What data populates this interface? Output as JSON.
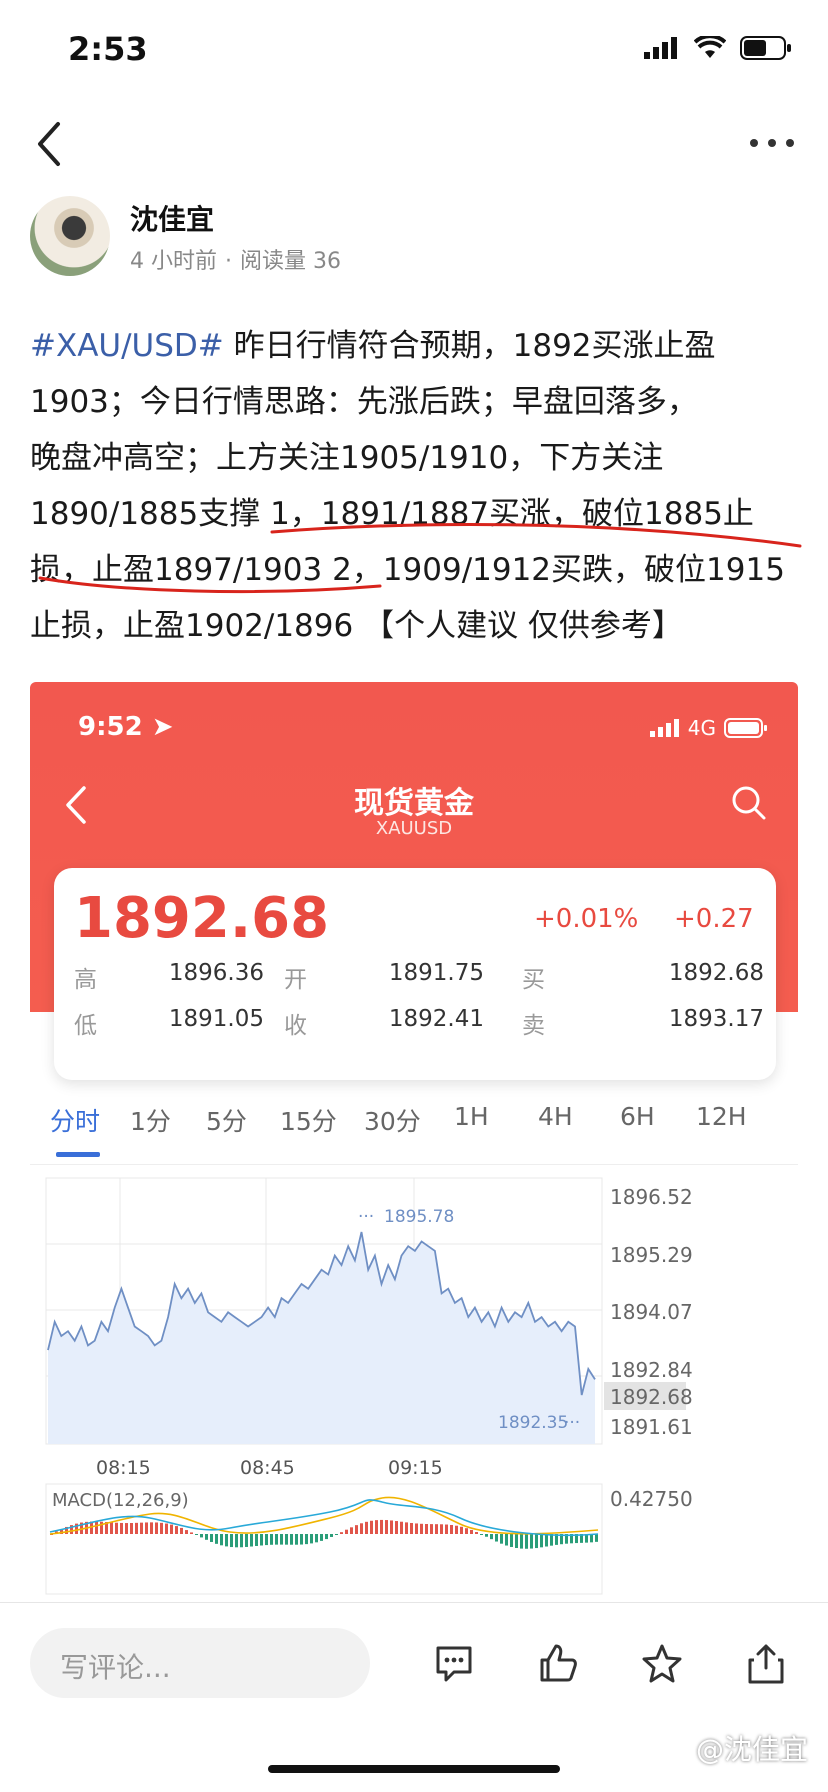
{
  "status_bar": {
    "time": "2:53"
  },
  "author": {
    "name": "沈佳宜",
    "time_ago": "4 小时前",
    "reads_label": "阅读量 36"
  },
  "post": {
    "hashtag": "#XAU/USD#",
    "lines": [
      " 昨日行情符合预期，1892买涨止盈",
      "1903；今日行情思路：先涨后跌；早盘回落多，",
      "晚盘冲高空；上方关注1905/1910，下方关注",
      "1890/1885支撑 1，1891/1887买涨，破位1885止",
      "损，止盈1897/1903 2，1909/1912买跌，破位1915",
      "止损，止盈1902/1896 【个人建议 仅供参考】"
    ]
  },
  "screenshot": {
    "time": "9:52",
    "network": "4G",
    "title": "现货黄金",
    "subtitle": "XAUUSD",
    "price": "1892.68",
    "change_pct": "+0.01%",
    "change_abs": "+0.27",
    "rows": [
      {
        "l1": "高",
        "v1": "1896.36",
        "l2": "开",
        "v2": "1891.75",
        "l3": "买",
        "v3": "1892.68"
      },
      {
        "l1": "低",
        "v1": "1891.05",
        "l2": "收",
        "v2": "1892.41",
        "l3": "卖",
        "v3": "1893.17"
      }
    ],
    "tabs": [
      "分时",
      "1分",
      "5分",
      "15分",
      "30分",
      "1H",
      "4H",
      "6H",
      "12H"
    ],
    "active_tab": "分时",
    "y_ticks": [
      "1896.52",
      "1895.29",
      "1894.07",
      "1892.84",
      "1891.61"
    ],
    "current_price_label": "1892.68",
    "high_marker": "1895.78",
    "low_marker": "1892.35",
    "x_ticks": [
      "08:15",
      "08:45",
      "09:15"
    ],
    "macd_label": "MACD(12,26,9)",
    "macd_value": "0.42750"
  },
  "bottom_bar": {
    "comment_placeholder": "写评论...",
    "watermark": "@沈佳宜"
  },
  "chart_data": {
    "type": "line",
    "title": "",
    "ylim": [
      1891.61,
      1896.52
    ],
    "x_ticks": [
      "08:15",
      "08:45",
      "09:15"
    ],
    "y_ticks": [
      1896.52,
      1895.29,
      1894.07,
      1892.84,
      1891.61
    ],
    "series": [
      {
        "values": [
          1893.3,
          1893.9,
          1893.6,
          1893.7,
          1893.5,
          1893.8,
          1893.4,
          1893.5,
          1893.9,
          1893.7,
          1894.2,
          1894.6,
          1894.2,
          1893.8,
          1893.7,
          1893.6,
          1893.4,
          1893.5,
          1894.0,
          1894.7,
          1894.4,
          1894.6,
          1894.3,
          1894.5,
          1894.1,
          1894.0,
          1893.9,
          1894.1,
          1894.0,
          1893.9,
          1893.8,
          1893.9,
          1894.0,
          1894.2,
          1894.0,
          1894.4,
          1894.3,
          1894.5,
          1894.7,
          1894.6,
          1894.8,
          1895.0,
          1894.9,
          1895.3,
          1895.1,
          1895.5,
          1895.2,
          1895.8,
          1895.0,
          1895.3,
          1894.7,
          1895.1,
          1894.8,
          1895.3,
          1895.5,
          1895.4,
          1895.6,
          1895.5,
          1895.4,
          1894.5,
          1894.6,
          1894.3,
          1894.4,
          1894.0,
          1894.2,
          1893.9,
          1894.1,
          1893.8,
          1894.2,
          1893.9,
          1894.1,
          1894.0,
          1894.3,
          1893.9,
          1894.0,
          1893.8,
          1893.9,
          1893.7,
          1893.9,
          1893.8,
          1892.35,
          1892.9,
          1892.68
        ]
      }
    ]
  }
}
